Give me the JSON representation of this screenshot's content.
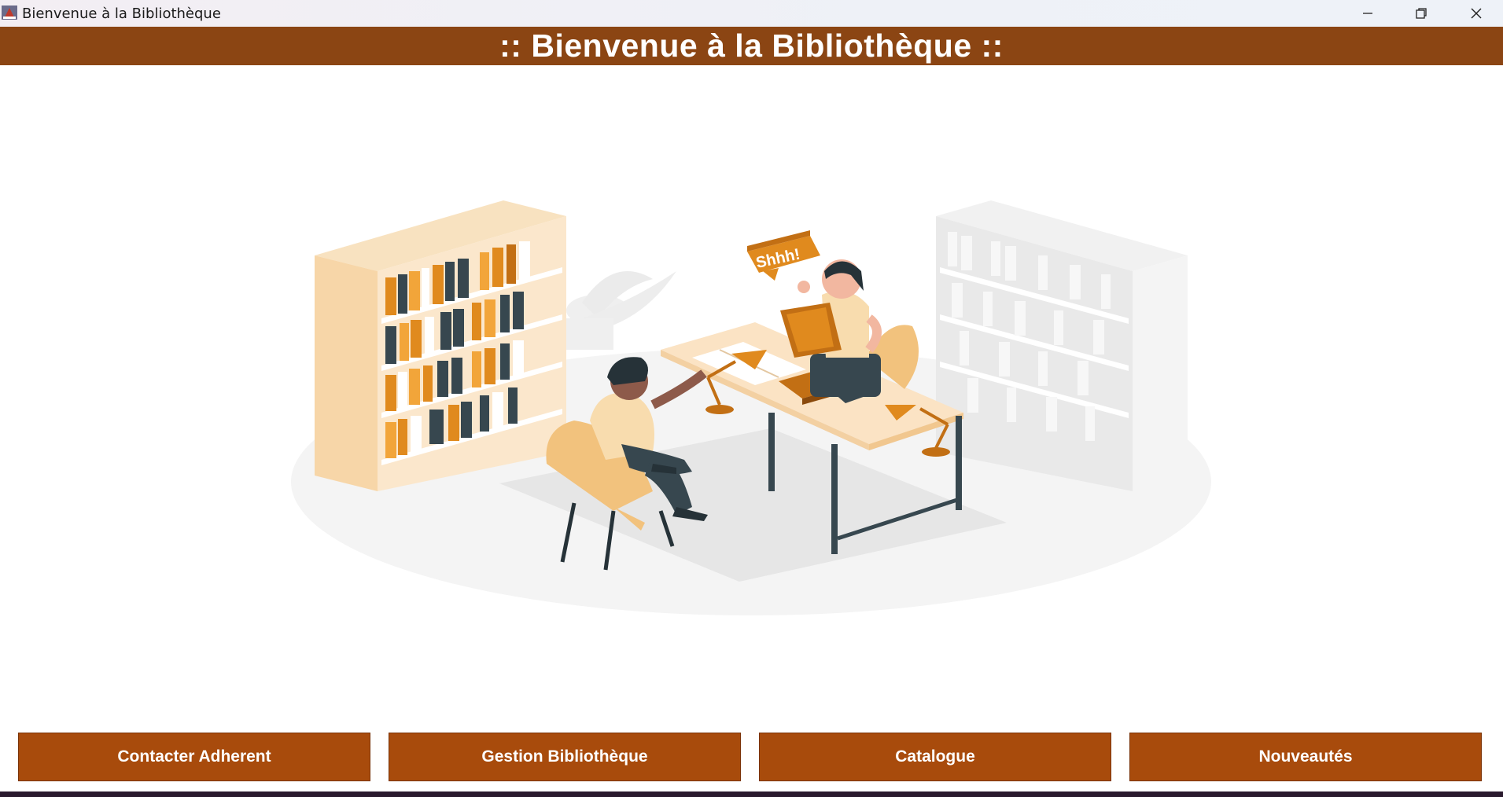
{
  "window": {
    "title": "Bienvenue à la Bibliothèque",
    "controls": [
      "minimize-icon",
      "restore-icon",
      "close-icon"
    ]
  },
  "header": {
    "title": ":: Bienvenue à la Bibliothèque ::",
    "background": "#8b4513"
  },
  "illustration": {
    "speech_bubble": "Shhh!"
  },
  "nav": {
    "buttons": [
      {
        "label": "Contacter Adherent"
      },
      {
        "label": "Gestion Bibliothèque"
      },
      {
        "label": "Catalogue"
      },
      {
        "label": "Nouveautés"
      }
    ],
    "button_color": "#a84b0c"
  }
}
